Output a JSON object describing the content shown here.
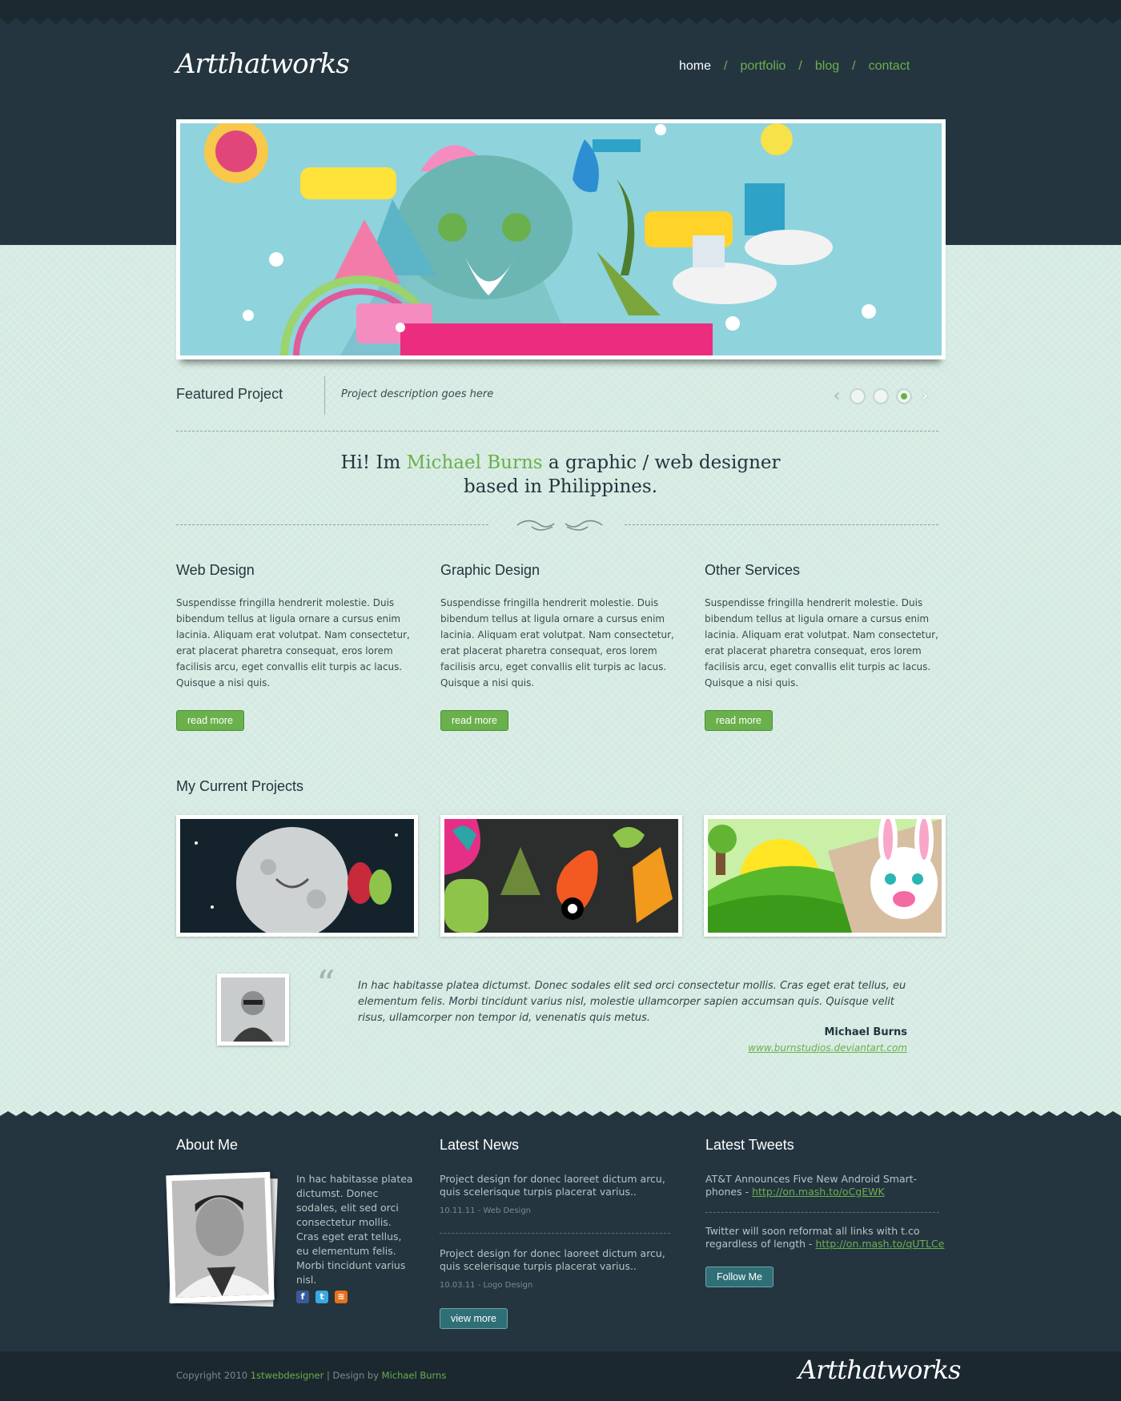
{
  "brand": {
    "logo_text": "Artthatworks"
  },
  "nav": {
    "items": [
      {
        "label": "home",
        "active": true
      },
      {
        "label": "portfolio",
        "active": false
      },
      {
        "label": "blog",
        "active": false
      },
      {
        "label": "contact",
        "active": false
      }
    ],
    "separator": "/"
  },
  "featured": {
    "title": "Featured Project",
    "description": "Project description goes here",
    "slides": 3,
    "active_slide": 3
  },
  "intro": {
    "greeting": "Hi! Im",
    "name": "Michael Burns",
    "rest": "a graphic / web designer",
    "line2": "based in Philippines."
  },
  "services": [
    {
      "title": "Web Design",
      "text": "Suspendisse fringilla hendrerit molestie. Duis bibendum tellus at ligula ornare a cursus enim lacinia. Aliquam erat volutpat. Nam consectetur, erat placerat pharetra consequat, eros lorem facilisis arcu, eget convallis elit turpis ac lacus. Quisque a nisi quis.",
      "button": "read more"
    },
    {
      "title": "Graphic Design",
      "text": "Suspendisse fringilla hendrerit molestie. Duis bibendum tellus at ligula ornare a cursus enim lacinia. Aliquam erat volutpat. Nam consectetur, erat placerat pharetra consequat, eros lorem facilisis arcu, eget convallis elit turpis ac lacus. Quisque a nisi quis.",
      "button": "read more"
    },
    {
      "title": "Other Services",
      "text": "Suspendisse fringilla hendrerit molestie. Duis bibendum tellus at ligula ornare a cursus enim lacinia. Aliquam erat volutpat. Nam consectetur, erat placerat pharetra consequat, eros lorem facilisis arcu, eget convallis elit turpis ac lacus. Quisque a nisi quis.",
      "button": "read more"
    }
  ],
  "projects": {
    "title": "My Current Projects"
  },
  "testimonial": {
    "quote": "In hac habitasse platea dictumst. Donec sodales elit sed orci consectetur mollis. Cras eget erat tellus, eu elementum felis. Morbi tincidunt varius nisl, molestie ullamcorper sapien accumsan quis. Quisque velit risus, ullamcorper non tempor id, venenatis quis metus.",
    "author": "Michael Burns",
    "link": "www.burnstudios.deviantart.com"
  },
  "footer": {
    "about": {
      "title": "About Me",
      "text": "In hac habitasse platea dictumst. Donec sodales, elit sed orci consectetur mollis. Cras eget erat tellus, eu elementum felis. Morbi tincidunt varius nisl."
    },
    "news": {
      "title": "Latest News",
      "items": [
        {
          "text": "Project design for donec laoreet dictum arcu, quis scelerisque turpis placerat varius..",
          "meta": "10.11.11 - Web Design"
        },
        {
          "text": "Project design for donec laoreet dictum arcu, quis scelerisque turpis placerat varius..",
          "meta": "10.03.11 - Logo Design"
        }
      ],
      "button": "view more"
    },
    "tweets": {
      "title": "Latest Tweets",
      "items": [
        {
          "text": "AT&T Announces Five New Android Smart-phones - ",
          "link": "http://on.mash.to/oCgEWK"
        },
        {
          "text": "Twitter will soon reformat all links with t.co regardless of length - ",
          "link": "http://on.mash.to/qUTLCe"
        }
      ],
      "button": "Follow Me"
    }
  },
  "bottom": {
    "copyright": "Copyright 2010",
    "site": "1stwebdesigner",
    "sep": "| Design by",
    "designer": "Michael Burns",
    "logo_text": "Artthatworks"
  },
  "colors": {
    "dark": "#243540",
    "accent": "#6ab04c",
    "background": "#d5eae2"
  }
}
